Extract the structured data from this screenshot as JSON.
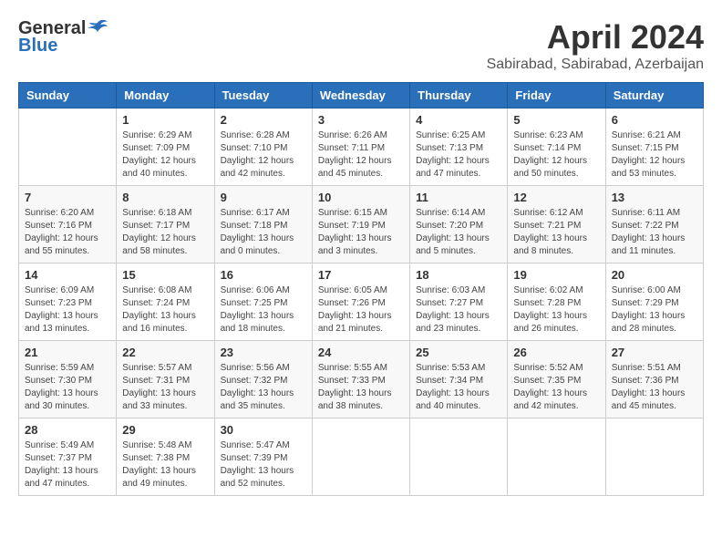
{
  "logo": {
    "general": "General",
    "blue": "Blue"
  },
  "title": "April 2024",
  "location": "Sabirabad, Sabirabad, Azerbaijan",
  "days_of_week": [
    "Sunday",
    "Monday",
    "Tuesday",
    "Wednesday",
    "Thursday",
    "Friday",
    "Saturday"
  ],
  "weeks": [
    [
      {
        "day": "",
        "info": ""
      },
      {
        "day": "1",
        "info": "Sunrise: 6:29 AM\nSunset: 7:09 PM\nDaylight: 12 hours\nand 40 minutes."
      },
      {
        "day": "2",
        "info": "Sunrise: 6:28 AM\nSunset: 7:10 PM\nDaylight: 12 hours\nand 42 minutes."
      },
      {
        "day": "3",
        "info": "Sunrise: 6:26 AM\nSunset: 7:11 PM\nDaylight: 12 hours\nand 45 minutes."
      },
      {
        "day": "4",
        "info": "Sunrise: 6:25 AM\nSunset: 7:13 PM\nDaylight: 12 hours\nand 47 minutes."
      },
      {
        "day": "5",
        "info": "Sunrise: 6:23 AM\nSunset: 7:14 PM\nDaylight: 12 hours\nand 50 minutes."
      },
      {
        "day": "6",
        "info": "Sunrise: 6:21 AM\nSunset: 7:15 PM\nDaylight: 12 hours\nand 53 minutes."
      }
    ],
    [
      {
        "day": "7",
        "info": "Sunrise: 6:20 AM\nSunset: 7:16 PM\nDaylight: 12 hours\nand 55 minutes."
      },
      {
        "day": "8",
        "info": "Sunrise: 6:18 AM\nSunset: 7:17 PM\nDaylight: 12 hours\nand 58 minutes."
      },
      {
        "day": "9",
        "info": "Sunrise: 6:17 AM\nSunset: 7:18 PM\nDaylight: 13 hours\nand 0 minutes."
      },
      {
        "day": "10",
        "info": "Sunrise: 6:15 AM\nSunset: 7:19 PM\nDaylight: 13 hours\nand 3 minutes."
      },
      {
        "day": "11",
        "info": "Sunrise: 6:14 AM\nSunset: 7:20 PM\nDaylight: 13 hours\nand 5 minutes."
      },
      {
        "day": "12",
        "info": "Sunrise: 6:12 AM\nSunset: 7:21 PM\nDaylight: 13 hours\nand 8 minutes."
      },
      {
        "day": "13",
        "info": "Sunrise: 6:11 AM\nSunset: 7:22 PM\nDaylight: 13 hours\nand 11 minutes."
      }
    ],
    [
      {
        "day": "14",
        "info": "Sunrise: 6:09 AM\nSunset: 7:23 PM\nDaylight: 13 hours\nand 13 minutes."
      },
      {
        "day": "15",
        "info": "Sunrise: 6:08 AM\nSunset: 7:24 PM\nDaylight: 13 hours\nand 16 minutes."
      },
      {
        "day": "16",
        "info": "Sunrise: 6:06 AM\nSunset: 7:25 PM\nDaylight: 13 hours\nand 18 minutes."
      },
      {
        "day": "17",
        "info": "Sunrise: 6:05 AM\nSunset: 7:26 PM\nDaylight: 13 hours\nand 21 minutes."
      },
      {
        "day": "18",
        "info": "Sunrise: 6:03 AM\nSunset: 7:27 PM\nDaylight: 13 hours\nand 23 minutes."
      },
      {
        "day": "19",
        "info": "Sunrise: 6:02 AM\nSunset: 7:28 PM\nDaylight: 13 hours\nand 26 minutes."
      },
      {
        "day": "20",
        "info": "Sunrise: 6:00 AM\nSunset: 7:29 PM\nDaylight: 13 hours\nand 28 minutes."
      }
    ],
    [
      {
        "day": "21",
        "info": "Sunrise: 5:59 AM\nSunset: 7:30 PM\nDaylight: 13 hours\nand 30 minutes."
      },
      {
        "day": "22",
        "info": "Sunrise: 5:57 AM\nSunset: 7:31 PM\nDaylight: 13 hours\nand 33 minutes."
      },
      {
        "day": "23",
        "info": "Sunrise: 5:56 AM\nSunset: 7:32 PM\nDaylight: 13 hours\nand 35 minutes."
      },
      {
        "day": "24",
        "info": "Sunrise: 5:55 AM\nSunset: 7:33 PM\nDaylight: 13 hours\nand 38 minutes."
      },
      {
        "day": "25",
        "info": "Sunrise: 5:53 AM\nSunset: 7:34 PM\nDaylight: 13 hours\nand 40 minutes."
      },
      {
        "day": "26",
        "info": "Sunrise: 5:52 AM\nSunset: 7:35 PM\nDaylight: 13 hours\nand 42 minutes."
      },
      {
        "day": "27",
        "info": "Sunrise: 5:51 AM\nSunset: 7:36 PM\nDaylight: 13 hours\nand 45 minutes."
      }
    ],
    [
      {
        "day": "28",
        "info": "Sunrise: 5:49 AM\nSunset: 7:37 PM\nDaylight: 13 hours\nand 47 minutes."
      },
      {
        "day": "29",
        "info": "Sunrise: 5:48 AM\nSunset: 7:38 PM\nDaylight: 13 hours\nand 49 minutes."
      },
      {
        "day": "30",
        "info": "Sunrise: 5:47 AM\nSunset: 7:39 PM\nDaylight: 13 hours\nand 52 minutes."
      },
      {
        "day": "",
        "info": ""
      },
      {
        "day": "",
        "info": ""
      },
      {
        "day": "",
        "info": ""
      },
      {
        "day": "",
        "info": ""
      }
    ]
  ]
}
